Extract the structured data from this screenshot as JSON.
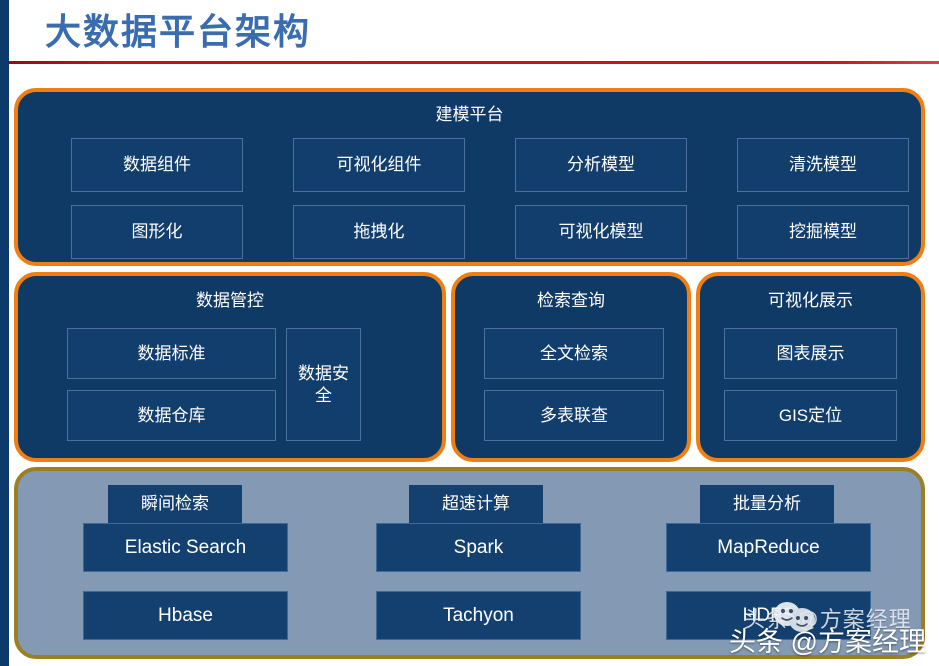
{
  "header": {
    "title": "大数据平台架构"
  },
  "colors": {
    "title_blue": "#3a6cb0",
    "rule_red": "#c0121c",
    "panel_fill": "#103A66",
    "panel_border_orange": "#F07F13",
    "infra_fill": "#8399B4",
    "infra_border_gold": "#9A7F25",
    "cell_border": "#4C7099",
    "left_strip": "#0c3a6b"
  },
  "panels": {
    "modeling": {
      "title": "建模平台",
      "row1": [
        "数据组件",
        "可视化组件",
        "分析模型",
        "清洗模型"
      ],
      "row2": [
        "图形化",
        "拖拽化",
        "可视化模型",
        "挖掘模型"
      ]
    },
    "governance": {
      "title": "数据管控",
      "left_items": [
        "数据标准",
        "数据仓库"
      ],
      "right_item": "数据安全"
    },
    "retrieval": {
      "title": "检索查询",
      "items": [
        "全文检索",
        "多表联查"
      ]
    },
    "visualization": {
      "title": "可视化展示",
      "items": [
        "图表展示",
        "GIS定位"
      ]
    },
    "infrastructure": {
      "columns": [
        {
          "label": "瞬间检索",
          "items": [
            "Elastic Search",
            "Hbase"
          ]
        },
        {
          "label": "超速计算",
          "items": [
            "Spark",
            "Tachyon"
          ]
        },
        {
          "label": "批量分析",
          "items": [
            "MapReduce",
            "HDFS"
          ]
        }
      ]
    }
  },
  "watermark": {
    "top_text": "头条 @方案经理",
    "bottom_text": "头条 @方案经理",
    "icon": "ghost-emoji-icon"
  }
}
